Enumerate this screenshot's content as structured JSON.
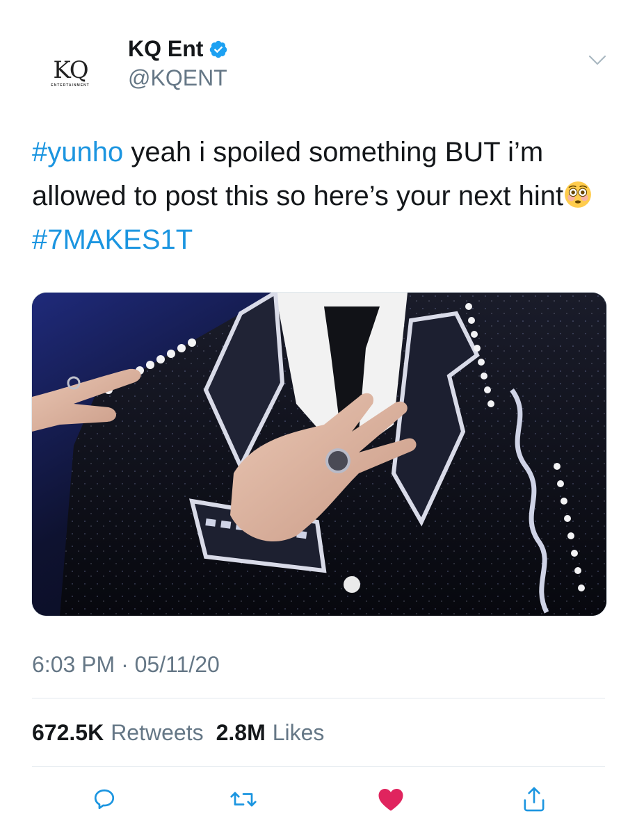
{
  "account": {
    "display_name": "KQ Ent",
    "handle": "@KQENT",
    "avatar_mark": "KQ",
    "avatar_sub": "ENTERTAINMENT",
    "verified": true
  },
  "tweet": {
    "hashtag_1": "#yunho",
    "text_1": " yeah i spoiled something BUT i’m allowed to post this so here’s your next hint",
    "emoji": "flushed-face-emoji",
    "hashtag_2": "#7MAKES1T",
    "timestamp": "6:03 PM · 05/11/20"
  },
  "stats": {
    "retweets_count": "672.5K",
    "retweets_label": "Retweets",
    "likes_count": "2.8M",
    "likes_label": "Likes"
  },
  "actions": {
    "reply_icon": "reply-icon",
    "retweet_icon": "retweet-icon",
    "like_icon": "heart-icon",
    "share_icon": "share-icon"
  },
  "colors": {
    "link": "#1b95e0",
    "secondary_text": "#657786",
    "primary_text": "#14171a",
    "like": "#e0245e",
    "divider": "#e1e8ed"
  }
}
